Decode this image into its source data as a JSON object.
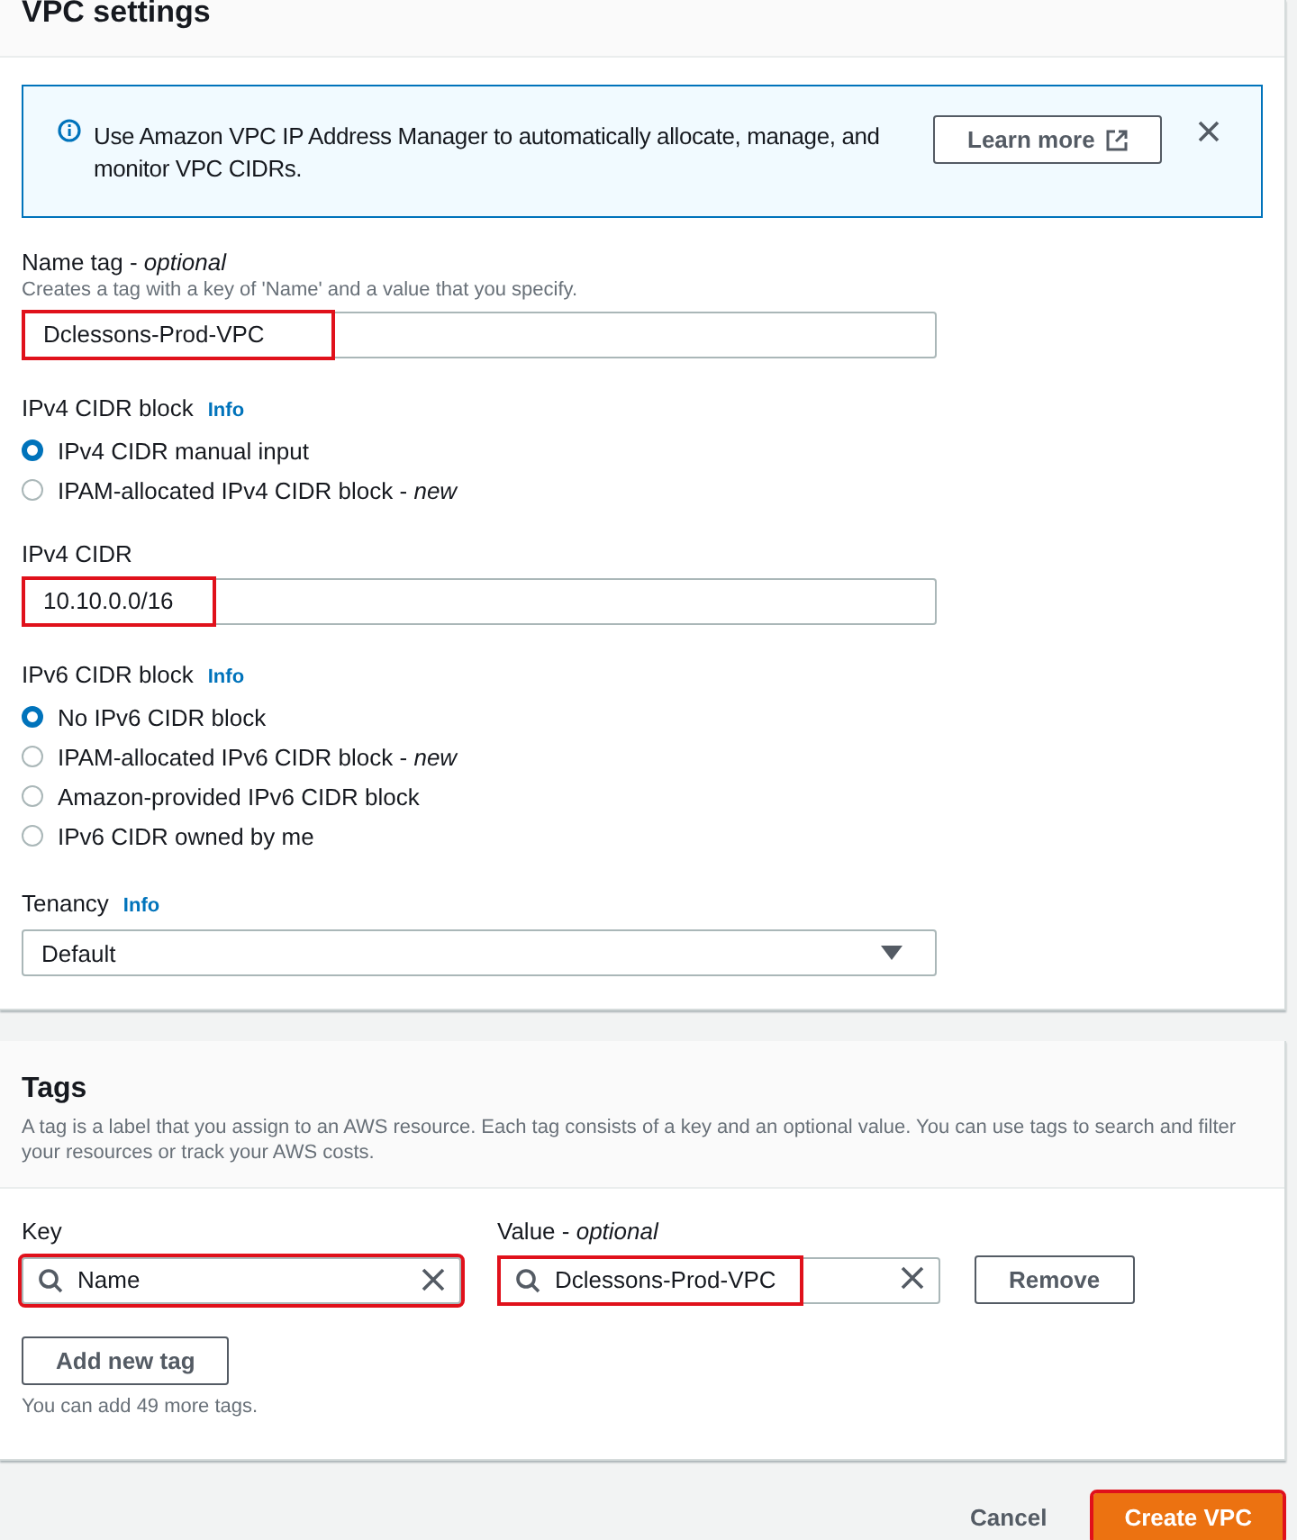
{
  "section": {
    "title": "VPC settings"
  },
  "alert": {
    "text": "Use Amazon VPC IP Address Manager to automatically allocate, manage, and monitor VPC CIDRs.",
    "button": "Learn more"
  },
  "name_tag": {
    "label": "Name tag - *optional*",
    "description": "Creates a tag with a key of 'Name' and a value that you specify.",
    "value": "Dclessons-Prod-VPC",
    "highlighted": true
  },
  "ipv4_cidr_block": {
    "label": "IPv4 CIDR block",
    "info": "Info",
    "options": [
      {
        "label": "IPv4 CIDR manual input",
        "selected": true
      },
      {
        "label": "IPAM-allocated IPv4 CIDR block - *new*",
        "selected": false
      }
    ]
  },
  "ipv4_cidr": {
    "label": "IPv4 CIDR",
    "value": "10.10.0.0/16",
    "highlighted": true
  },
  "ipv6_cidr_block": {
    "label": "IPv6 CIDR block",
    "info": "Info",
    "options": [
      {
        "label": "No IPv6 CIDR block",
        "selected": true
      },
      {
        "label": "IPAM-allocated IPv6 CIDR block - *new*",
        "selected": false
      },
      {
        "label": "Amazon-provided IPv6 CIDR block",
        "selected": false
      },
      {
        "label": "IPv6 CIDR owned by me",
        "selected": false
      }
    ]
  },
  "tenancy": {
    "label": "Tenancy",
    "info": "Info",
    "value": "Default"
  },
  "tags": {
    "title": "Tags",
    "description": "A tag is a label that you assign to an AWS resource. Each tag consists of a key and an optional value. You can use tags to search and filter your resources or track your AWS costs.",
    "key_label": "Key",
    "value_label": "Value - *optional*",
    "rows": [
      {
        "key": "Name",
        "value": "Dclessons-Prod-VPC",
        "key_highlighted": true,
        "value_highlighted": true,
        "remove": "Remove"
      }
    ],
    "add": "Add new tag",
    "hint": "You can add 49 more tags."
  },
  "footer": {
    "cancel": "Cancel",
    "create": "Create VPC",
    "create_highlighted": true
  }
}
